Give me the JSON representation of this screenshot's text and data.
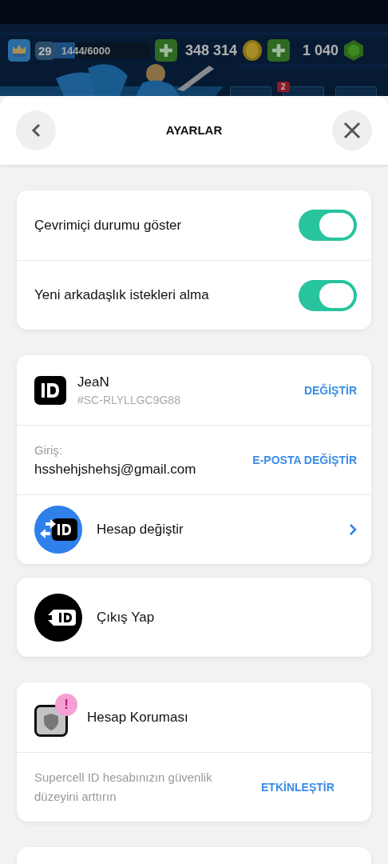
{
  "hud": {
    "level_badge": "29",
    "xp": "1444/6000",
    "xp_bar": {
      "level": 0.24
    },
    "gold": "348 314",
    "gems": "1 040",
    "notification_badge": "2"
  },
  "header": {
    "title": "AYARLAR"
  },
  "toggles": [
    {
      "label": "Çevrimiçi durumu göster",
      "on": true
    },
    {
      "label": "Yeni arkadaşlık istekleri alma",
      "on": true
    }
  ],
  "account": {
    "name": "JeaN",
    "tag": "#SC-RLYLLGC9G88",
    "change_label": "DEĞİŞTİR",
    "login_label": "Giriş:",
    "email": "hsshehjshehsj@gmail.com",
    "email_change_label": "E-POSTA DEĞİŞTİR",
    "switch_label": "Hesap değiştir"
  },
  "logout": {
    "label": "Çıkış Yap"
  },
  "protection": {
    "title": "Hesap Koruması",
    "alert": "!",
    "description": "Supercell ID hesabınızın güvenlik düzeyini arttırın",
    "action": "ETKİNLEŞTİR"
  }
}
